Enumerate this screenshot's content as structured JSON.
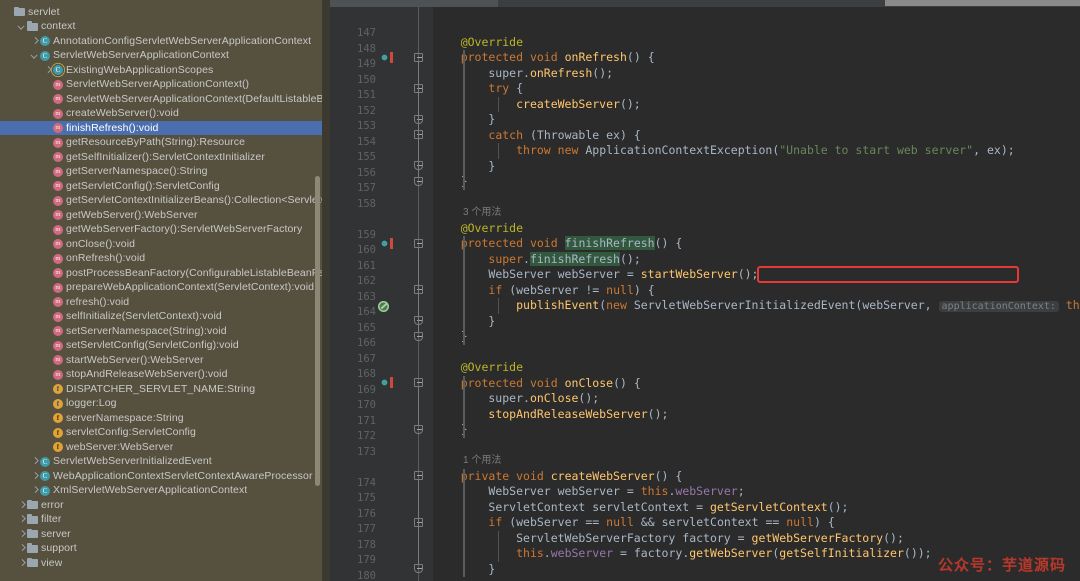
{
  "sidebar": {
    "scrollbar": "structure-scrollbar",
    "tree": [
      {
        "indent": 0,
        "arrow": "none",
        "icon": "folder",
        "label": "servlet"
      },
      {
        "indent": 1,
        "arrow": "down",
        "icon": "folder",
        "label": "context"
      },
      {
        "indent": 2,
        "arrow": "right",
        "icon": "class",
        "label": "AnnotationConfigServletWebServerApplicationContext"
      },
      {
        "indent": 2,
        "arrow": "down",
        "icon": "class",
        "label": "ServletWebServerApplicationContext"
      },
      {
        "indent": 3,
        "arrow": "right",
        "icon": "class-inner",
        "label": "ExistingWebApplicationScopes"
      },
      {
        "indent": 3,
        "arrow": "none",
        "icon": "method",
        "label": "ServletWebServerApplicationContext()"
      },
      {
        "indent": 3,
        "arrow": "none",
        "icon": "method",
        "label": "ServletWebServerApplicationContext(DefaultListableBeanFactory):void"
      },
      {
        "indent": 3,
        "arrow": "none",
        "icon": "method",
        "label": "createWebServer():void"
      },
      {
        "indent": 3,
        "arrow": "none",
        "icon": "method",
        "label": "finishRefresh():void",
        "selected": true
      },
      {
        "indent": 3,
        "arrow": "none",
        "icon": "method",
        "label": "getResourceByPath(String):Resource"
      },
      {
        "indent": 3,
        "arrow": "none",
        "icon": "method",
        "label": "getSelfInitializer():ServletContextInitializer"
      },
      {
        "indent": 3,
        "arrow": "none",
        "icon": "method",
        "label": "getServerNamespace():String"
      },
      {
        "indent": 3,
        "arrow": "none",
        "icon": "method",
        "label": "getServletConfig():ServletConfig"
      },
      {
        "indent": 3,
        "arrow": "none",
        "icon": "method",
        "label": "getServletContextInitializerBeans():Collection<ServletContextIni"
      },
      {
        "indent": 3,
        "arrow": "none",
        "icon": "method",
        "label": "getWebServer():WebServer"
      },
      {
        "indent": 3,
        "arrow": "none",
        "icon": "method",
        "label": "getWebServerFactory():ServletWebServerFactory"
      },
      {
        "indent": 3,
        "arrow": "none",
        "icon": "method",
        "label": "onClose():void"
      },
      {
        "indent": 3,
        "arrow": "none",
        "icon": "method",
        "label": "onRefresh():void"
      },
      {
        "indent": 3,
        "arrow": "none",
        "icon": "method",
        "label": "postProcessBeanFactory(ConfigurableListableBeanFactory):void"
      },
      {
        "indent": 3,
        "arrow": "none",
        "icon": "method",
        "label": "prepareWebApplicationContext(ServletContext):void"
      },
      {
        "indent": 3,
        "arrow": "none",
        "icon": "method",
        "label": "refresh():void"
      },
      {
        "indent": 3,
        "arrow": "none",
        "icon": "method",
        "label": "selfInitialize(ServletContext):void"
      },
      {
        "indent": 3,
        "arrow": "none",
        "icon": "method",
        "label": "setServerNamespace(String):void"
      },
      {
        "indent": 3,
        "arrow": "none",
        "icon": "method",
        "label": "setServletConfig(ServletConfig):void"
      },
      {
        "indent": 3,
        "arrow": "none",
        "icon": "method",
        "label": "startWebServer():WebServer"
      },
      {
        "indent": 3,
        "arrow": "none",
        "icon": "method",
        "label": "stopAndReleaseWebServer():void"
      },
      {
        "indent": 3,
        "arrow": "none",
        "icon": "field-static",
        "label": "DISPATCHER_SERVLET_NAME:String"
      },
      {
        "indent": 3,
        "arrow": "none",
        "icon": "field-static",
        "label": "logger:Log"
      },
      {
        "indent": 3,
        "arrow": "none",
        "icon": "field",
        "label": "serverNamespace:String"
      },
      {
        "indent": 3,
        "arrow": "none",
        "icon": "field",
        "label": "servletConfig:ServletConfig"
      },
      {
        "indent": 3,
        "arrow": "none",
        "icon": "field",
        "label": "webServer:WebServer"
      },
      {
        "indent": 2,
        "arrow": "right",
        "icon": "class",
        "label": "ServletWebServerInitializedEvent"
      },
      {
        "indent": 2,
        "arrow": "right",
        "icon": "class",
        "label": "WebApplicationContextServletContextAwareProcessor"
      },
      {
        "indent": 2,
        "arrow": "right",
        "icon": "class",
        "label": "XmlServletWebServerApplicationContext"
      },
      {
        "indent": 1,
        "arrow": "right",
        "icon": "folder",
        "label": "error"
      },
      {
        "indent": 1,
        "arrow": "right",
        "icon": "folder",
        "label": "filter"
      },
      {
        "indent": 1,
        "arrow": "right",
        "icon": "folder",
        "label": "server"
      },
      {
        "indent": 1,
        "arrow": "right",
        "icon": "folder",
        "label": "support"
      },
      {
        "indent": 1,
        "arrow": "right",
        "icon": "folder",
        "label": "view"
      }
    ]
  },
  "editor": {
    "first_line_number": 147,
    "last_line_number": 180,
    "line_numbers": [
      147,
      148,
      149,
      150,
      151,
      152,
      153,
      154,
      155,
      156,
      157,
      158,
      159,
      160,
      161,
      162,
      163,
      164,
      165,
      166,
      167,
      168,
      169,
      170,
      171,
      172,
      173,
      174,
      175,
      176,
      177,
      178,
      179,
      180
    ],
    "usage_hints": [
      {
        "line": 159,
        "text": "3 个用法"
      },
      {
        "line": 174,
        "text": "1 个用法"
      }
    ],
    "gutter_markers": [
      {
        "line": 149,
        "type": "overridden-method-icon"
      },
      {
        "line": 160,
        "type": "overridden-method-icon"
      },
      {
        "line": 164,
        "type": "recursive-call-icon"
      },
      {
        "line": 169,
        "type": "overridden-method-icon"
      }
    ],
    "highlight_box": {
      "line": 162,
      "color": "#e53935",
      "code": "WebServer webServer = startWebServer();"
    },
    "inlay_hints": [
      {
        "line": 164,
        "text": "applicationContext:"
      }
    ],
    "code_lines": [
      {
        "n": 147,
        "text": ""
      },
      {
        "n": 148,
        "text": "    @Override"
      },
      {
        "n": 149,
        "text": "    protected void onRefresh() {"
      },
      {
        "n": 150,
        "text": "        super.onRefresh();"
      },
      {
        "n": 151,
        "text": "        try {"
      },
      {
        "n": 152,
        "text": "            createWebServer();"
      },
      {
        "n": 153,
        "text": "        }"
      },
      {
        "n": 154,
        "text": "        catch (Throwable ex) {"
      },
      {
        "n": 155,
        "text": "            throw new ApplicationContextException(\"Unable to start web server\", ex);"
      },
      {
        "n": 156,
        "text": "        }"
      },
      {
        "n": 157,
        "text": "    }"
      },
      {
        "n": 158,
        "text": ""
      },
      {
        "n": 159,
        "text": "    @Override"
      },
      {
        "n": 160,
        "text": "    protected void finishRefresh() {"
      },
      {
        "n": 161,
        "text": "        super.finishRefresh();"
      },
      {
        "n": 162,
        "text": "        WebServer webServer = startWebServer();"
      },
      {
        "n": 163,
        "text": "        if (webServer != null) {"
      },
      {
        "n": 164,
        "text": "            publishEvent(new ServletWebServerInitializedEvent(webServer, applicationContext: this));"
      },
      {
        "n": 165,
        "text": "        }"
      },
      {
        "n": 166,
        "text": "    }"
      },
      {
        "n": 167,
        "text": ""
      },
      {
        "n": 168,
        "text": "    @Override"
      },
      {
        "n": 169,
        "text": "    protected void onClose() {"
      },
      {
        "n": 170,
        "text": "        super.onClose();"
      },
      {
        "n": 171,
        "text": "        stopAndReleaseWebServer();"
      },
      {
        "n": 172,
        "text": "    }"
      },
      {
        "n": 173,
        "text": ""
      },
      {
        "n": 174,
        "text": "    private void createWebServer() {"
      },
      {
        "n": 175,
        "text": "        WebServer webServer = this.webServer;"
      },
      {
        "n": 176,
        "text": "        ServletContext servletContext = getServletContext();"
      },
      {
        "n": 177,
        "text": "        if (webServer == null && servletContext == null) {"
      },
      {
        "n": 178,
        "text": "            ServletWebServerFactory factory = getWebServerFactory();"
      },
      {
        "n": 179,
        "text": "            this.webServer = factory.getWebServer(getSelfInitializer());"
      },
      {
        "n": 180,
        "text": "        }"
      }
    ]
  },
  "watermark": {
    "text": "公众号：芋道源码",
    "color": "#c0392b"
  },
  "theme": {
    "sidebar_bg": "#56513f",
    "editor_bg": "#2b2b2b",
    "gutter_bg": "#313335",
    "selection_bg": "#4b6eaf",
    "keyword": "#cc7832",
    "annotation": "#bbb529",
    "string": "#6a8759",
    "method": "#ffc66d",
    "field": "#9876aa",
    "identifier_highlight": "#32593d"
  }
}
